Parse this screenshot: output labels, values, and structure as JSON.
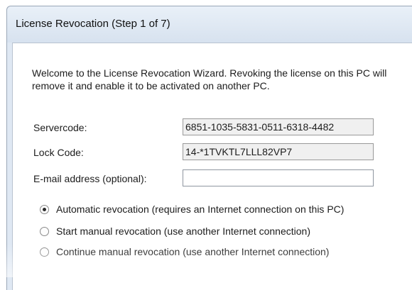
{
  "window": {
    "title": "License Revocation (Step 1 of 7)"
  },
  "intro_text": "Welcome to the License Revocation Wizard. Revoking the license on this PC will remove it and enable it to be activated on another PC.",
  "fields": {
    "servercode": {
      "label": "Servercode:",
      "value": "6851-1035-5831-0511-6318-4482"
    },
    "lock_code": {
      "label": "Lock Code:",
      "value": "14-*1TVKTL7LLL82VP7"
    },
    "email": {
      "label": "E-mail address (optional):",
      "value": "",
      "placeholder": ""
    }
  },
  "options": [
    {
      "label": "Automatic revocation (requires an Internet connection on this PC)",
      "selected": true
    },
    {
      "label": "Start manual revocation (use another Internet connection)",
      "selected": false
    },
    {
      "label": "Continue manual revocation (use another Internet connection)",
      "selected": false
    }
  ]
}
